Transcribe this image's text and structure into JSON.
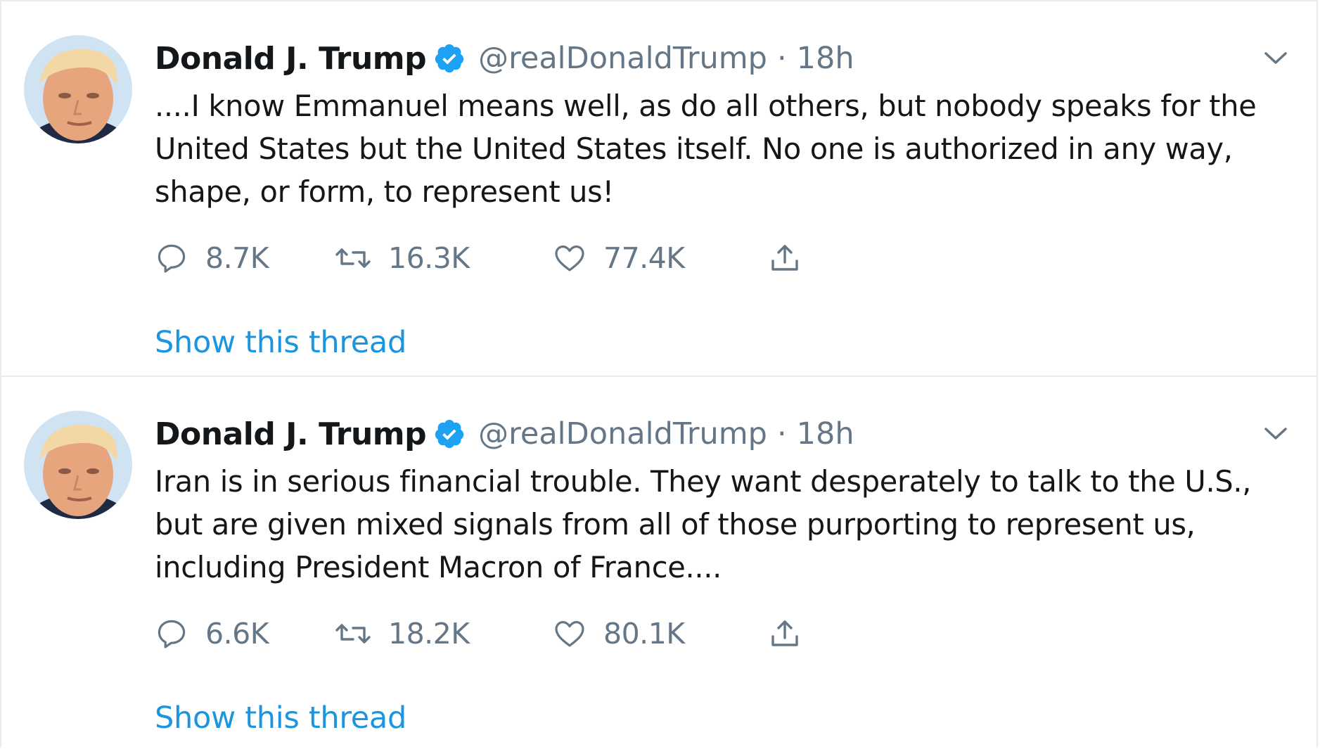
{
  "tweets": [
    {
      "author": {
        "name": "Donald J. Trump",
        "handle": "@realDonaldTrump",
        "verified": true
      },
      "separator": "·",
      "time": "18h",
      "text": "....I know Emmanuel means well, as do all others, but nobody speaks for the\nUnited States but the United States itself. No one is authorized in any way,\nshape, or form, to represent us!",
      "stats": {
        "replies": "8.7K",
        "retweets": "16.3K",
        "likes": "77.4K"
      },
      "show_thread": "Show this thread"
    },
    {
      "author": {
        "name": "Donald J. Trump",
        "handle": "@realDonaldTrump",
        "verified": true
      },
      "separator": "·",
      "time": "18h",
      "text": "Iran is in serious financial trouble. They want desperately to talk to the U.S.,\nbut are given mixed signals from all of those purporting to represent us,\nincluding President Macron of France....",
      "stats": {
        "replies": "6.6K",
        "retweets": "18.2K",
        "likes": "80.1K"
      },
      "show_thread": "Show this thread"
    }
  ],
  "icons": {
    "verified": "verified-badge-icon",
    "caret": "chevron-down-icon",
    "reply": "reply-icon",
    "retweet": "retweet-icon",
    "like": "heart-icon",
    "share": "share-icon"
  },
  "colors": {
    "text": "#14171a",
    "secondary": "#657786",
    "link": "#1b95e0",
    "verified": "#1da1f2",
    "divider": "#e6ecf0"
  }
}
